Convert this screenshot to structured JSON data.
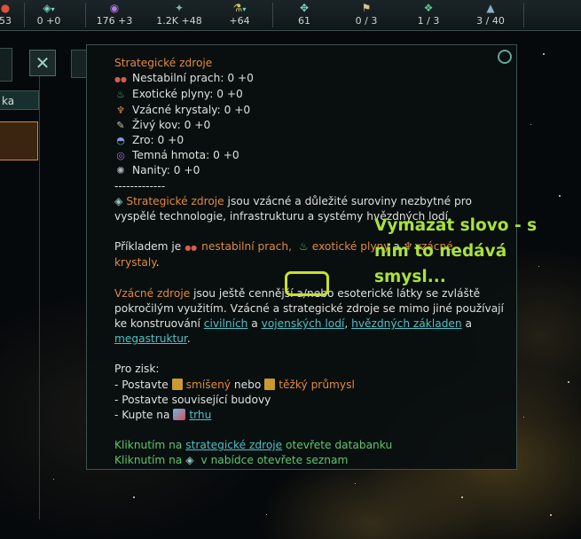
{
  "topbar": {
    "items": [
      {
        "icon": "minerals-icon",
        "glyph": "●",
        "value": "53",
        "color": "#e05040"
      },
      {
        "icon": "unity-icon",
        "glyph": "◈",
        "value": "0 +0",
        "color": "#7fd6c8"
      },
      {
        "icon": "influence-icon",
        "glyph": "◉",
        "value": "176 +3",
        "color": "#b07ae0"
      },
      {
        "icon": "alloys-icon",
        "glyph": "✦",
        "value": "1.2K +48",
        "color": "#8ab0a8"
      },
      {
        "icon": "research-icon",
        "glyph": "⚗",
        "value": "+64",
        "color": "#d0c060"
      },
      {
        "icon": "amenities-icon",
        "glyph": "✥",
        "value": "61",
        "color": "#7fd6c8"
      },
      {
        "icon": "planets-icon",
        "glyph": "⚑",
        "value": "0 / 3",
        "color": "#d0c890"
      },
      {
        "icon": "sectors-icon",
        "glyph": "❖",
        "value": "1 / 3",
        "color": "#60c080"
      },
      {
        "icon": "fleet-icon",
        "glyph": "▲",
        "value": "3 / 40",
        "color": "#8ab0c8"
      }
    ]
  },
  "left_panel": {
    "tab_label": "ka",
    "close_glyph": "✕"
  },
  "tooltip": {
    "title": "Strategické zdroje",
    "resources": [
      {
        "icon": "volatile-motes-icon",
        "glyph": "●●",
        "color": "#d06048",
        "text": "Nestabilní prach: 0 +0"
      },
      {
        "icon": "exotic-gases-icon",
        "glyph": "♨",
        "color": "#4cc060",
        "text": "Exotické plyny: 0 +0"
      },
      {
        "icon": "rare-crystals-icon",
        "glyph": "♆",
        "color": "#e0903c",
        "text": "Vzácné krystaly: 0 +0"
      },
      {
        "icon": "living-metal-icon",
        "glyph": "✎",
        "color": "#c8c8b0",
        "text": "Živý kov: 0 +0"
      },
      {
        "icon": "zro-icon",
        "glyph": "◓",
        "color": "#8098d8",
        "text": "Zro: 0 +0"
      },
      {
        "icon": "dark-matter-icon",
        "glyph": "◎",
        "color": "#a070e0",
        "text": "Temná hmota: 0 +0"
      },
      {
        "icon": "nanites-icon",
        "glyph": "✺",
        "color": "#b0b0b8",
        "text": "Nanity: 0 +0"
      }
    ],
    "divider": "-------------",
    "p1_icon": "◈",
    "p1_key": "Strategické zdroje",
    "p1_rest": " jsou vzácné a důležité suroviny nezbytné pro",
    "p1_line2": "vyspělé technologie, infrastrukturu a systémy hvězdných lodí.",
    "p2_prefix": "Příkladem je ",
    "p2_item1": "nestabilní prach,",
    "p2_item2": "exotické plyny",
    "p2_conj": " a ",
    "p2_item3": "vzácné",
    "p2_line2": "krystaly",
    "p2_end": ".",
    "p3_key": "Vzácné zdroje",
    "p3_a": " jsou ještě cennější a/nebo esoterické látky se zvláště",
    "p3_b": "pokročilým využitím. Vzácné a strategické zdroje se mimo jiné používají",
    "p3_c_prefix": "ke konstruování ",
    "p3_link1": "civilních",
    "p3_c_and": " a ",
    "p3_link2": "vojenských lodí",
    "p3_c_comma": ", ",
    "p3_link3": "hvězdných základen",
    "p3_c_and2": " a",
    "p3_link4": "megastruktur",
    "p3_end": ".",
    "gain_title": "Pro zisk:",
    "gain1_prefix": "- Postavte ",
    "gain1_a": "smíšený",
    "gain1_mid": " nebo ",
    "gain1_b": "těžký průmysl",
    "gain2": "- Postavte související budovy",
    "gain3_prefix": "- Kupte na ",
    "gain3_link": "trhu",
    "foot1_prefix": "Kliknutím na ",
    "foot1_link": "strategické zdroje",
    "foot1_suffix": " otevřete databanku",
    "foot2_prefix": "Kliknutím na ",
    "foot2_icon": "◈",
    "foot2_suffix": " v nabídce otevřete seznam"
  },
  "annotation": {
    "text": "Vymazat slovo - s nim to nedává smysl...",
    "color": "#a9e23a"
  }
}
